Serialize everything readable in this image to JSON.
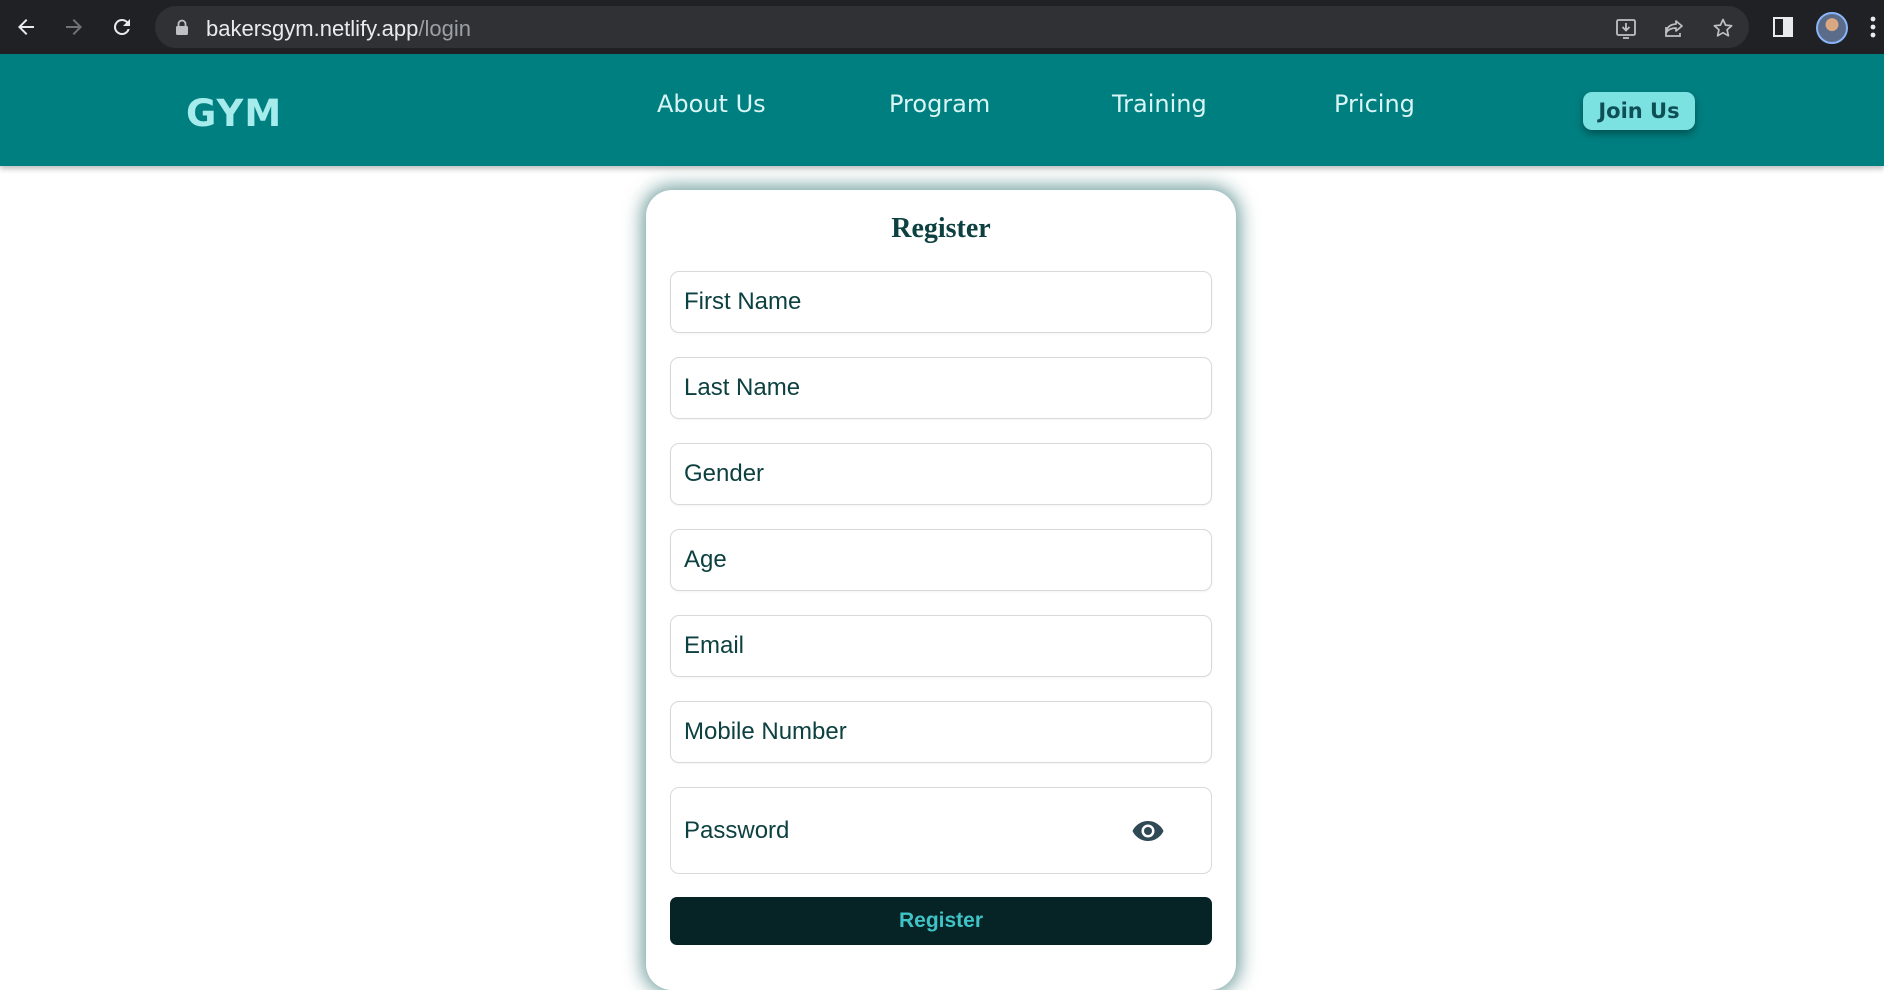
{
  "browser": {
    "url_host": "bakersgym.netlify.app",
    "url_path": "/login",
    "icons": [
      "back-icon",
      "forward-icon",
      "reload-icon",
      "lock-icon",
      "install-icon",
      "share-icon",
      "bookmark-star-icon",
      "side-panel-icon",
      "profile-avatar",
      "kebab-menu-icon"
    ]
  },
  "header": {
    "logo": "GYM",
    "nav": [
      "About Us",
      "Program",
      "Training",
      "Pricing"
    ],
    "cta": "Join Us"
  },
  "form": {
    "title": "Register",
    "fields": [
      {
        "placeholder": "First Name"
      },
      {
        "placeholder": "Last Name"
      },
      {
        "placeholder": "Gender"
      },
      {
        "placeholder": "Age"
      },
      {
        "placeholder": "Email"
      },
      {
        "placeholder": "Mobile Number"
      }
    ],
    "password_placeholder": "Password",
    "submit_label": "Register"
  },
  "colors": {
    "header_bg": "#007f80",
    "logo": "#a6ecec",
    "cta_bg": "#7ce1e1",
    "submit_bg": "#062326",
    "submit_text": "#3fc3c7",
    "text_dark_teal": "#0d4040"
  }
}
